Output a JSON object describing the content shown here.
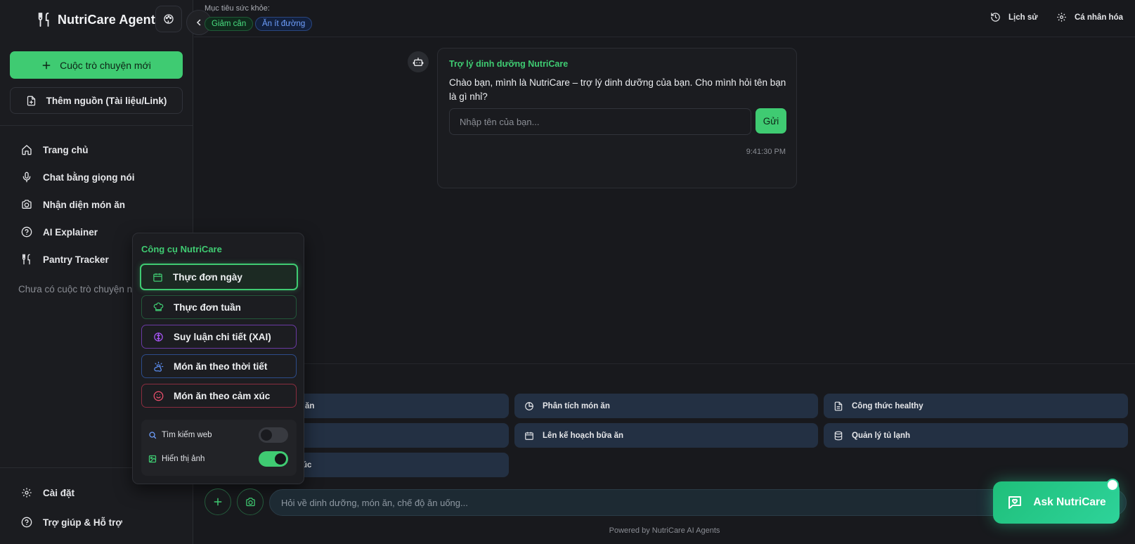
{
  "app": {
    "title": "NutriCare Agents",
    "accent_color": "#3fcb72"
  },
  "sidebar": {
    "new_chat_label": "Cuộc trò chuyện mới",
    "add_source_label": "Thêm nguồn (Tài liệu/Link)",
    "nav": [
      {
        "label": "Trang chủ",
        "icon": "home-icon"
      },
      {
        "label": "Chat bằng giọng nói",
        "icon": "mic-icon"
      },
      {
        "label": "Nhận diện món ăn",
        "icon": "camera-icon"
      },
      {
        "label": "AI Explainer",
        "icon": "help-circle-icon"
      },
      {
        "label": "Pantry Tracker",
        "icon": "utensils-icon"
      }
    ],
    "empty_history": "Chưa có cuộc trò chuyện nào",
    "bottom": [
      {
        "label": "Cài đặt",
        "icon": "gear-icon"
      },
      {
        "label": "Trợ giúp & Hỗ trợ",
        "icon": "help-circle-icon"
      }
    ]
  },
  "topbar": {
    "goal_label": "Mục tiêu sức khỏe:",
    "goals": [
      "Giảm cân",
      "Ăn ít đường"
    ],
    "history_label": "Lịch sử",
    "personalize_label": "Cá nhân hóa"
  },
  "chat": {
    "sender": "Trợ lý dinh dưỡng NutriCare",
    "text": "Chào bạn, mình là NutriCare – trợ lý dinh dưỡng của bạn. Cho mình hỏi tên bạn là gì nhỉ?",
    "name_placeholder": "Nhập tên của bạn...",
    "send_label": "Gửi",
    "time": "9:41:30 PM"
  },
  "quick_actions": [
    {
      "label": "ăn",
      "icon": "utensils-icon"
    },
    {
      "label": "Phân tích món ăn",
      "icon": "pie-chart-icon"
    },
    {
      "label": "Công thức healthy",
      "icon": "document-icon"
    },
    {
      "label": "",
      "icon": ""
    },
    {
      "label": "Lên kế hoạch bữa ăn",
      "icon": "calendar-icon"
    },
    {
      "label": "Quản lý tủ lạnh",
      "icon": "database-icon"
    },
    {
      "label": "úc",
      "icon": ""
    }
  ],
  "tools": {
    "title": "Công cụ NutriCare",
    "items": [
      {
        "label": "Thực đơn ngày",
        "icon": "calendar-icon",
        "color": "#3fcb72"
      },
      {
        "label": "Thực đơn tuần",
        "icon": "chef-hat-icon",
        "color": "#3fcb72"
      },
      {
        "label": "Suy luận chi tiết (XAI)",
        "icon": "brain-icon",
        "color": "#a855f7"
      },
      {
        "label": "Món ăn theo thời tiết",
        "icon": "cloud-sun-icon",
        "color": "#5b8def"
      },
      {
        "label": "Món ăn theo cảm xúc",
        "icon": "smile-icon",
        "color": "#f0506e"
      }
    ],
    "web_search_label": "Tìm kiếm web",
    "web_search_on": false,
    "show_images_label": "Hiển thị ảnh",
    "show_images_on": true
  },
  "composer": {
    "placeholder": "Hỏi về dinh dưỡng, món ăn, chế độ ăn uống...",
    "footer": "Powered by NutriCare AI Agents"
  },
  "fab": {
    "label": "Ask NutriCare"
  }
}
